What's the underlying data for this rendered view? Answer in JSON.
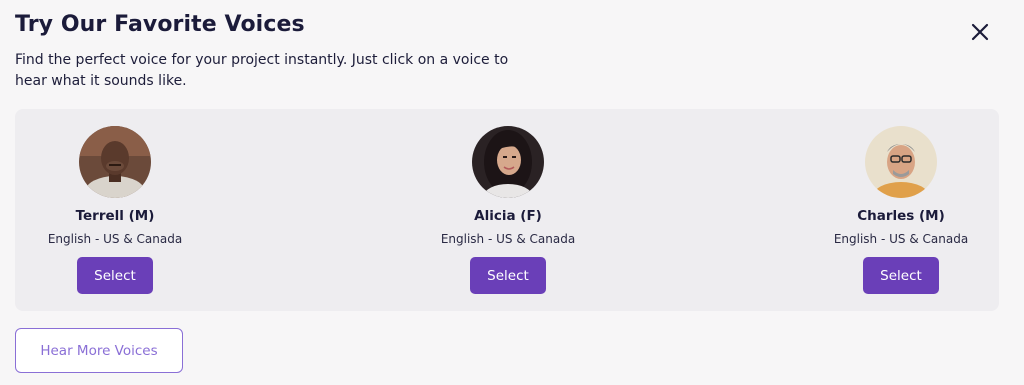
{
  "modal": {
    "title": "Try Our Favorite Voices",
    "subtitle": "Find the perfect voice for your project instantly. Just click on a voice to hear what it sounds like.",
    "close_icon": "close-icon"
  },
  "voices": [
    {
      "name": "Terrell (M)",
      "language": "English - US & Canada",
      "select_label": "Select",
      "avatar": "avatar-terrell"
    },
    {
      "name": "Alicia (F)",
      "language": "English - US & Canada",
      "select_label": "Select",
      "avatar": "avatar-alicia"
    },
    {
      "name": "Charles (M)",
      "language": "English - US & Canada",
      "select_label": "Select",
      "avatar": "avatar-charles"
    }
  ],
  "footer": {
    "more_label": "Hear More Voices"
  },
  "colors": {
    "accent": "#6a3fb8",
    "outline_accent": "#8a6fd6",
    "panel_bg": "#eeedf0",
    "page_bg": "#f7f6f7",
    "text": "#1b1b3a"
  }
}
